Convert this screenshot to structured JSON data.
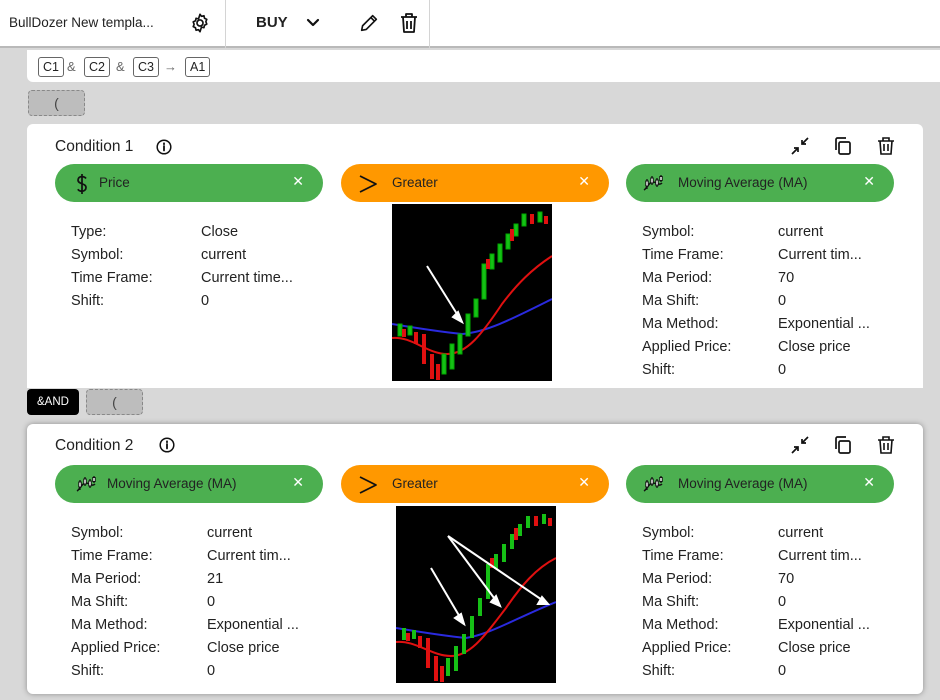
{
  "topbar": {
    "title": "BullDozer New templa...",
    "side": "BUY"
  },
  "formula": {
    "chips": [
      "C1",
      "C2",
      "C3",
      "A1"
    ],
    "ops": [
      "&",
      "&",
      "→"
    ]
  },
  "paren_label": "(",
  "and_label": "&AND",
  "conditions": [
    {
      "title": "Condition 1",
      "left": {
        "label": "Price",
        "icon": "dollar-icon",
        "color": "#4caf50"
      },
      "op": {
        "label": "Greater",
        "icon": "greater-than-icon",
        "color": "#ff9800"
      },
      "right": {
        "label": "Moving Average (MA)",
        "icon": "ma-chart-icon",
        "color": "#4caf50"
      },
      "left_props": [
        {
          "k": "Type:",
          "v": "Close"
        },
        {
          "k": "Symbol:",
          "v": "current"
        },
        {
          "k": "Time Frame:",
          "v": "Current time..."
        },
        {
          "k": "Shift:",
          "v": "0"
        }
      ],
      "right_props": [
        {
          "k": "Symbol:",
          "v": "current"
        },
        {
          "k": "Time Frame:",
          "v": "Current tim..."
        },
        {
          "k": "Ma Period:",
          "v": "70"
        },
        {
          "k": "Ma Shift:",
          "v": "0"
        },
        {
          "k": "Ma Method:",
          "v": "Exponential ..."
        },
        {
          "k": "Applied Price:",
          "v": "Close price"
        },
        {
          "k": "Shift:",
          "v": "0"
        }
      ]
    },
    {
      "title": "Condition 2",
      "left": {
        "label": "Moving Average (MA)",
        "icon": "ma-chart-icon",
        "color": "#4caf50"
      },
      "op": {
        "label": "Greater",
        "icon": "greater-than-icon",
        "color": "#ff9800"
      },
      "right": {
        "label": "Moving Average (MA)",
        "icon": "ma-chart-icon",
        "color": "#4caf50"
      },
      "left_props": [
        {
          "k": "Symbol:",
          "v": "current"
        },
        {
          "k": "Time Frame:",
          "v": "Current tim..."
        },
        {
          "k": "Ma Period:",
          "v": "21"
        },
        {
          "k": "Ma Shift:",
          "v": "0"
        },
        {
          "k": "Ma Method:",
          "v": "Exponential ..."
        },
        {
          "k": "Applied Price:",
          "v": "Close price"
        },
        {
          "k": "Shift:",
          "v": "0"
        }
      ],
      "right_props": [
        {
          "k": "Symbol:",
          "v": "current"
        },
        {
          "k": "Time Frame:",
          "v": "Current tim..."
        },
        {
          "k": "Ma Period:",
          "v": "70"
        },
        {
          "k": "Ma Shift:",
          "v": "0"
        },
        {
          "k": "Ma Method:",
          "v": "Exponential ..."
        },
        {
          "k": "Applied Price:",
          "v": "Close price"
        },
        {
          "k": "Shift:",
          "v": "0"
        }
      ]
    }
  ],
  "colors": {
    "green": "#4caf50",
    "orange": "#ff9800",
    "and_button": "#000000"
  }
}
